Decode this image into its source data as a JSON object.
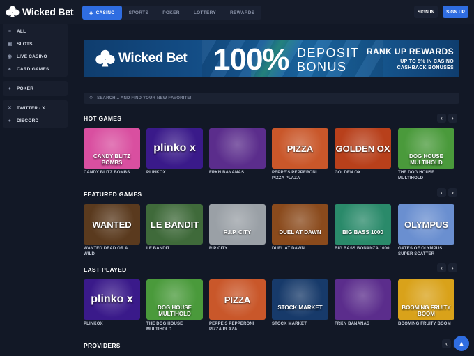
{
  "brand": {
    "name": "Wicked Bet",
    "accent": "#2f6de1"
  },
  "topnav": {
    "tabs": [
      {
        "label": "CASINO",
        "active": true
      },
      {
        "label": "SPORTS"
      },
      {
        "label": "POKER"
      },
      {
        "label": "LOTTERY"
      },
      {
        "label": "REWARDS"
      }
    ],
    "signin": "SIGN IN",
    "signup": "SIGN UP"
  },
  "sidebar": {
    "groups": [
      [
        {
          "label": "ALL",
          "icon": "all-icon"
        },
        {
          "label": "SLOTS",
          "icon": "slots-icon"
        },
        {
          "label": "LIVE CASINO",
          "icon": "live-casino-icon"
        },
        {
          "label": "CARD GAMES",
          "icon": "card-games-icon"
        }
      ],
      [
        {
          "label": "POKER",
          "icon": "poker-icon"
        }
      ],
      [
        {
          "label": "TWITTER / X",
          "icon": "x-icon"
        },
        {
          "label": "DISCORD",
          "icon": "discord-icon"
        }
      ]
    ]
  },
  "banner": {
    "logo": "Wicked Bet",
    "percent": "100%",
    "line1": "DEPOSIT",
    "line2": "BONUS",
    "rank": "RANK UP REWARDS",
    "sub1": "UP TO 5% IN CASINO",
    "sub2": "CASHBACK BONUSES"
  },
  "search": {
    "placeholder": "SEARCH... AND FIND YOUR NEW FAVORITE!"
  },
  "sections": [
    {
      "title": "HOT GAMES",
      "games": [
        {
          "name": "CANDY BLITZ BOMBS",
          "art": "CANDY BLITZ BOMBS",
          "bg": "#d94fa0"
        },
        {
          "name": "PLINKOX",
          "art": "plinko x",
          "bg": "#3a1a8a"
        },
        {
          "name": "FRKN BANANAS",
          "art": "",
          "bg": "#5b2d8c"
        },
        {
          "name": "PEPPE'S PEPPERONI PIZZA PLAZA",
          "art": "PIZZA",
          "bg": "#c9572a"
        },
        {
          "name": "GOLDEN OX",
          "art": "GOLDEN OX",
          "bg": "#b8401b"
        },
        {
          "name": "THE DOG HOUSE MULTIHOLD",
          "art": "DOG HOUSE MULTIHOLD",
          "bg": "#4a9a3b"
        }
      ]
    },
    {
      "title": "FEATURED GAMES",
      "games": [
        {
          "name": "WANTED DEAD OR A WILD",
          "art": "WANTED",
          "bg": "#5a3a1e"
        },
        {
          "name": "LE BANDIT",
          "art": "LE BANDIT",
          "bg": "#3f6a3a"
        },
        {
          "name": "RIP CITY",
          "art": "R.I.P. CITY",
          "bg": "#9aa0a6"
        },
        {
          "name": "DUEL AT DAWN",
          "art": "DUEL AT DAWN",
          "bg": "#8a4a1c"
        },
        {
          "name": "BIG BASS BONANZA 1000",
          "art": "BIG BASS 1000",
          "bg": "#2a8a6a"
        },
        {
          "name": "GATES OF OLYMPUS SUPER SCATTER",
          "art": "OLYMPUS",
          "bg": "#6a8fd0"
        }
      ]
    },
    {
      "title": "LAST PLAYED",
      "games": [
        {
          "name": "PLINKOX",
          "art": "plinko x",
          "bg": "#3a1a8a"
        },
        {
          "name": "THE DOG HOUSE MULTIHOLD",
          "art": "DOG HOUSE MULTIHOLD",
          "bg": "#4a9a3b"
        },
        {
          "name": "PEPPE'S PEPPERONI PIZZA PLAZA",
          "art": "PIZZA",
          "bg": "#c9572a"
        },
        {
          "name": "STOCK MARKET",
          "art": "STOCK MARKET",
          "bg": "#173a6a"
        },
        {
          "name": "FRKN BANANAS",
          "art": "",
          "bg": "#5b2d8c"
        },
        {
          "name": "BOOMING FRUITY BOOM",
          "art": "BOOMING FRUITY BOOM",
          "bg": "#d9a21a"
        }
      ]
    },
    {
      "title": "PROVIDERS",
      "games": []
    }
  ]
}
